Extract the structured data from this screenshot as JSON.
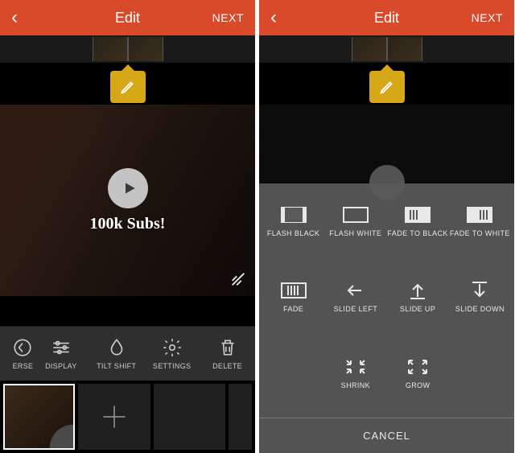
{
  "header": {
    "title": "Edit",
    "next": "NEXT"
  },
  "preview": {
    "overlay_text": "100k Subs!"
  },
  "toolbar": [
    {
      "name": "reverse",
      "label": "ERSE"
    },
    {
      "name": "display",
      "label": "DISPLAY"
    },
    {
      "name": "tiltshift",
      "label": "TILT SHIFT"
    },
    {
      "name": "settings",
      "label": "SETTINGS"
    },
    {
      "name": "delete",
      "label": "DELETE"
    }
  ],
  "transitions": [
    {
      "name": "flash-black",
      "label": "FLASH BLACK"
    },
    {
      "name": "flash-white",
      "label": "FLASH WHITE"
    },
    {
      "name": "fade-to-black",
      "label": "FADE TO BLACK"
    },
    {
      "name": "fade-to-white",
      "label": "FADE TO WHITE"
    },
    {
      "name": "fade",
      "label": "FADE"
    },
    {
      "name": "slide-left",
      "label": "SLIDE LEFT"
    },
    {
      "name": "slide-up",
      "label": "SLIDE UP"
    },
    {
      "name": "slide-down",
      "label": "SLIDE DOWN"
    },
    {
      "name": "shrink",
      "label": "SHRINK"
    },
    {
      "name": "grow",
      "label": "GROW"
    }
  ],
  "cancel": "CANCEL"
}
